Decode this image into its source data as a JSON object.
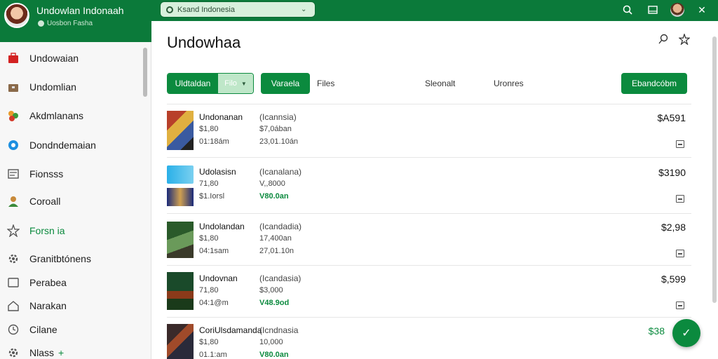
{
  "app": {
    "title": "Undowlan Indonaah",
    "subtitle": "Uosbon Fasha"
  },
  "search": {
    "value": "Ksand Indonesia",
    "placeholder": ""
  },
  "top_icons": [
    "search-icon",
    "window-icon",
    "user-avatar",
    "close-icon"
  ],
  "sidebar": {
    "items": [
      {
        "label": "Undowaian",
        "icon": "bag-icon",
        "active": false
      },
      {
        "label": "Undomlian",
        "icon": "briefcase-icon",
        "active": false
      },
      {
        "label": "Akdmlanans",
        "icon": "people-icon",
        "active": false
      },
      {
        "label": "Dondndemaian",
        "icon": "circle-icon",
        "active": false
      },
      {
        "label": "Fionsss",
        "icon": "card-icon",
        "active": false
      },
      {
        "label": "Coroall",
        "icon": "user-icon",
        "active": false
      },
      {
        "label": "Forsn ia",
        "icon": "star-icon",
        "active": true
      },
      {
        "label": "Granitbtónens",
        "icon": "gear-icon",
        "active": false
      },
      {
        "label": "Perabea",
        "icon": "folder-icon",
        "active": false
      },
      {
        "label": "Narakan",
        "icon": "home-icon",
        "active": false
      },
      {
        "label": "Cilane",
        "icon": "clock-icon",
        "active": false
      },
      {
        "label": "Nlass",
        "icon": "gear-icon",
        "active": false,
        "plus": "+"
      }
    ]
  },
  "main": {
    "title": "Undowhaa",
    "toolbar": {
      "split_primary": "Uldtaldan",
      "split_secondary": "Filo",
      "button2": "Varaela",
      "link1": "Files",
      "link2": "Sleonalt",
      "link3": "Uronres",
      "right_button": "Ebandcóbm"
    },
    "rows": [
      {
        "name": "Undonanan",
        "tag": "(Icannsia)",
        "l2a": "$1,80",
        "l2b": "$7,0ában",
        "l3a": "01:18ám",
        "l3b": "23,01.10án",
        "green": false,
        "price": "$A591"
      },
      {
        "name": "Udolasisn",
        "tag": "(Icanalana)",
        "l2a": "71,80",
        "l2b": "V,,8000",
        "l3a": "$1.Iorsl",
        "l3b": "V80.0an",
        "green": true,
        "price": "$3190"
      },
      {
        "name": "Undolandan",
        "tag": "(Icandadia)",
        "l2a": "$1,80",
        "l2b": "17,400an",
        "l3a": "04:1sam",
        "l3b": "27,01.10n",
        "green": false,
        "price": "$2,98"
      },
      {
        "name": "Undovnan",
        "tag": "(Icandasia)",
        "l2a": "71,80",
        "l2b": "$3,000",
        "l3a": "04:1@m",
        "l3b": "V48.9od",
        "green": true,
        "price": "$,599"
      },
      {
        "name": "CoriUlsdamanda",
        "tag": "(Icndnasia",
        "l2a": "$1,80",
        "l2b": "10,000",
        "l3a": "01.1:am",
        "l3b": "V80.0an",
        "green": true,
        "price": "$38"
      }
    ]
  },
  "colors": {
    "brand": "#0b7a3a",
    "accent": "#0b8a3e",
    "search_bg": "#d7f0dc"
  }
}
